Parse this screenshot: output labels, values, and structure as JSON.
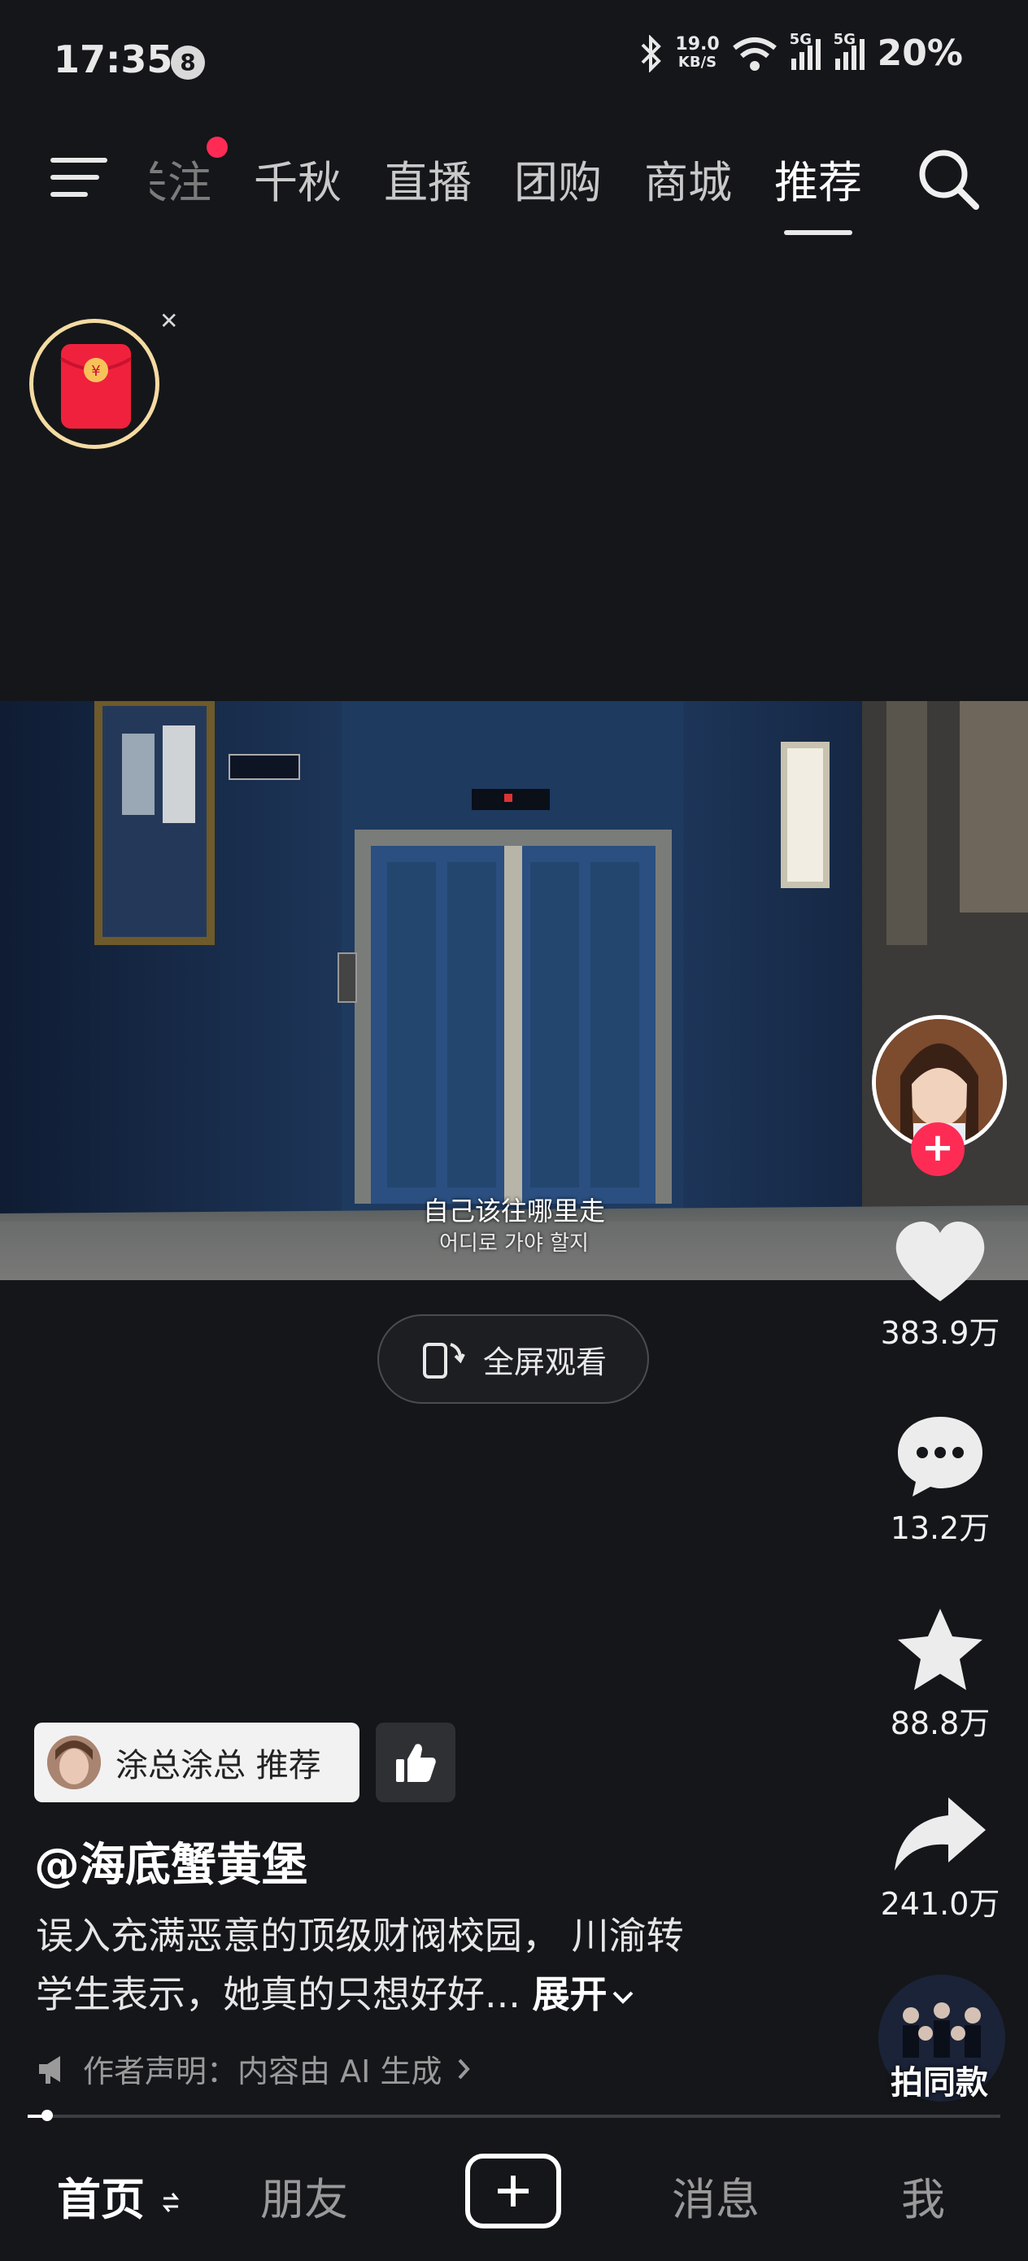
{
  "status": {
    "time": "17:35",
    "notif_count": "8",
    "speed_value": "19.0",
    "speed_unit": "KB/S",
    "signal1": "5G",
    "signal2": "5G",
    "battery": "20%"
  },
  "nav": {
    "tabs": [
      {
        "label": "关注",
        "display": "关注"
      },
      {
        "label": "千秋"
      },
      {
        "label": "直播"
      },
      {
        "label": "团购"
      },
      {
        "label": "商城"
      },
      {
        "label": "推荐"
      }
    ],
    "active_tab": "推荐"
  },
  "video": {
    "subtitle_cn": "自己该往哪里走",
    "subtitle_kr": "어디로 가야 할지",
    "fullscreen_label": "全屏观看"
  },
  "rail": {
    "likes": "383.9万",
    "comments": "13.2万",
    "favorites": "88.8万",
    "shares": "241.0万",
    "same_style": "拍同款"
  },
  "post": {
    "recommender": "涂总涂总 推荐",
    "author": "@海底蟹黄堡",
    "description_line1": "误入充满恶意的顶级财阀校园， 川渝转",
    "description_line2": "学生表示，她真的只想好好... ",
    "expand": "展开",
    "ai_note": "作者声明：内容由 AI 生成",
    "progress": 0.02
  },
  "tabbar": {
    "home": "首页",
    "friends": "朋友",
    "messages": "消息",
    "me": "我"
  }
}
